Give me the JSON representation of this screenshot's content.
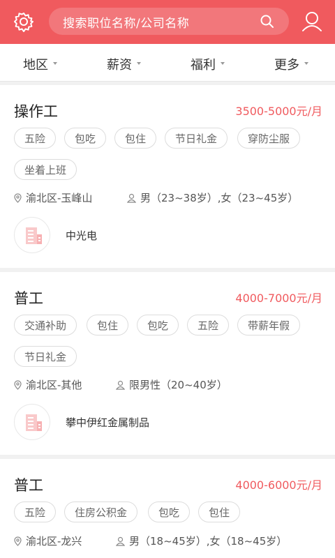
{
  "header": {
    "search_placeholder": "搜索职位名称/公司名称",
    "brand_color": "#f05a5e",
    "icons": [
      "gear-icon",
      "search-icon",
      "user-icon"
    ]
  },
  "filters": [
    {
      "label": "地区"
    },
    {
      "label": "薪资"
    },
    {
      "label": "福利"
    },
    {
      "label": "更多"
    }
  ],
  "jobs": [
    {
      "title": "操作工",
      "salary": "3500-5000元/月",
      "tags": [
        "五险",
        "包吃",
        "包住",
        "节日礼金",
        "穿防尘服",
        "坐着上班"
      ],
      "location": "渝北区-玉峰山",
      "requirement": "男（23~38岁）,女（23~45岁）",
      "company": "中光电"
    },
    {
      "title": "普工",
      "salary": "4000-7000元/月",
      "tags": [
        "交通补助",
        "包住",
        "包吃",
        "五险",
        "带薪年假",
        "节日礼金"
      ],
      "location": "渝北区-其他",
      "requirement": "限男性（20~40岁）",
      "company": "攀中伊红金属制品"
    },
    {
      "title": "普工",
      "salary": "4000-6000元/月",
      "tags": [
        "五险",
        "住房公积金",
        "包吃",
        "包住"
      ],
      "location": "渝北区-龙兴",
      "requirement": "男（18~45岁）,女（18~45岁）",
      "company": ""
    }
  ]
}
